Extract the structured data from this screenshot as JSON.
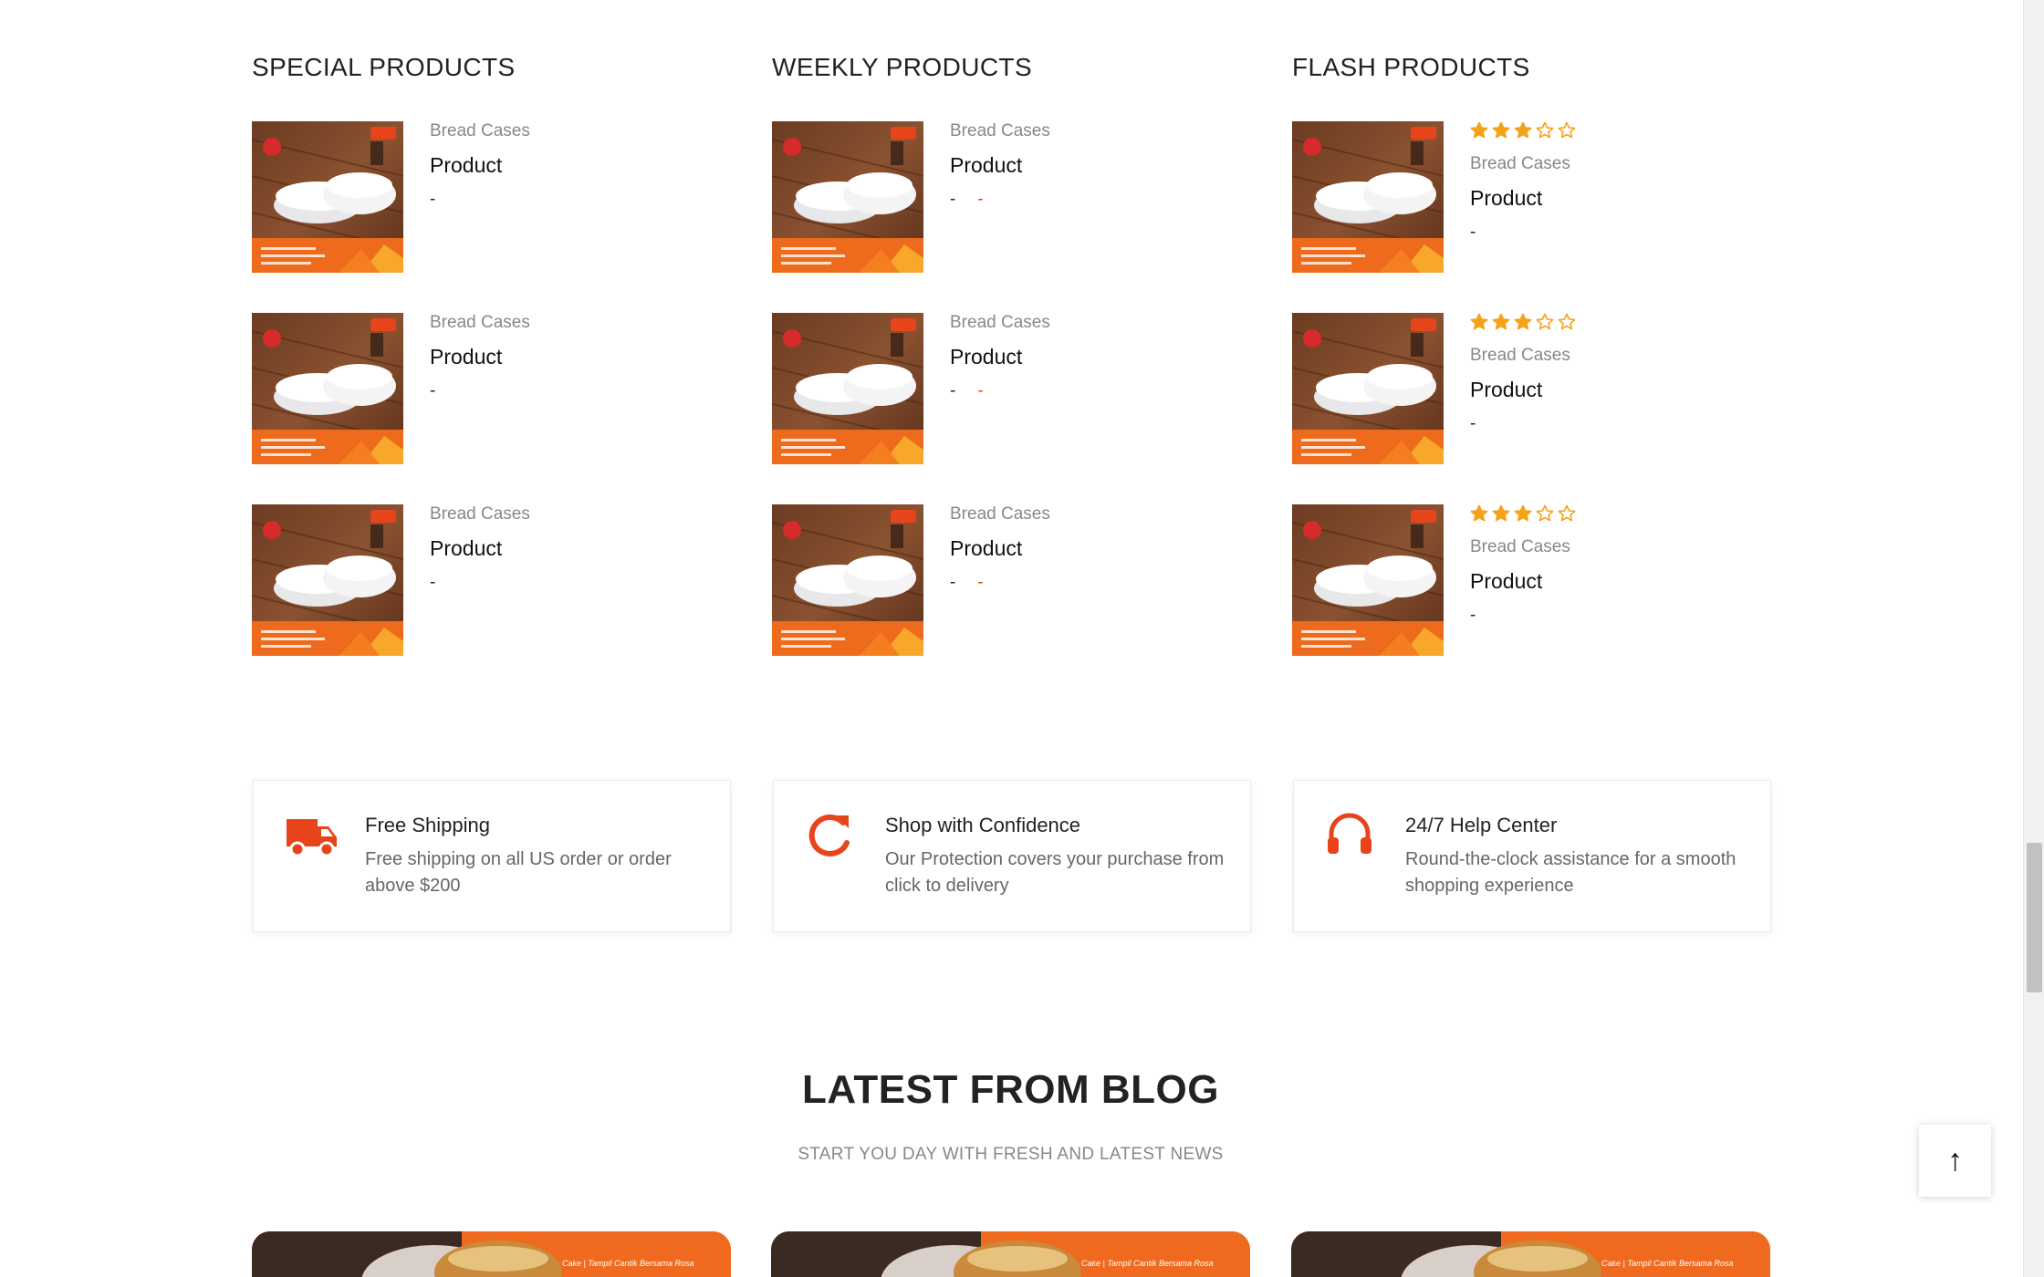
{
  "columns": [
    {
      "title": "SPECIAL PRODUCTS",
      "show_rating": false,
      "items": [
        {
          "category": "Bread Cases",
          "name": "Product",
          "price": "-",
          "old_price": ""
        },
        {
          "category": "Bread Cases",
          "name": "Product",
          "price": "-",
          "old_price": ""
        },
        {
          "category": "Bread Cases",
          "name": "Product",
          "price": "-",
          "old_price": ""
        }
      ]
    },
    {
      "title": "WEEKLY PRODUCTS",
      "show_rating": false,
      "items": [
        {
          "category": "Bread Cases",
          "name": "Product",
          "price": "-",
          "old_price": "-"
        },
        {
          "category": "Bread Cases",
          "name": "Product",
          "price": "-",
          "old_price": "-"
        },
        {
          "category": "Bread Cases",
          "name": "Product",
          "price": "-",
          "old_price": "-"
        }
      ]
    },
    {
      "title": "FLASH PRODUCTS",
      "show_rating": true,
      "items": [
        {
          "category": "Bread Cases",
          "name": "Product",
          "price": "-",
          "old_price": "",
          "rating": 3,
          "rating_max": 5
        },
        {
          "category": "Bread Cases",
          "name": "Product",
          "price": "-",
          "old_price": "",
          "rating": 3,
          "rating_max": 5
        },
        {
          "category": "Bread Cases",
          "name": "Product",
          "price": "-",
          "old_price": "",
          "rating": 3,
          "rating_max": 5
        }
      ]
    }
  ],
  "features": [
    {
      "icon": "truck-icon",
      "title": "Free Shipping",
      "description": "Free shipping on all US order or order above $200"
    },
    {
      "icon": "refresh-icon",
      "title": "Shop with Confidence",
      "description": "Our Protection covers your purchase from click to delivery"
    },
    {
      "icon": "headphones-icon",
      "title": "24/7 Help Center",
      "description": "Round-the-clock assistance for a smooth shopping experience"
    }
  ],
  "blog": {
    "title": "LATEST FROM BLOG",
    "subtitle": "START YOU DAY WITH FRESH AND LATEST NEWS",
    "cards": [
      {
        "tag": "Cake  |  Tampil Cantik Bersama Rosa"
      },
      {
        "tag": "Cake  |  Tampil Cantik Bersama Rosa"
      },
      {
        "tag": "Cake  |  Tampil Cantik Bersama Rosa"
      }
    ]
  },
  "back_to_top": {
    "icon": "arrow-up-icon",
    "label": "↑"
  },
  "colors": {
    "accent": "#e8441c",
    "star": "#f5a21b",
    "text_muted": "#888888"
  }
}
